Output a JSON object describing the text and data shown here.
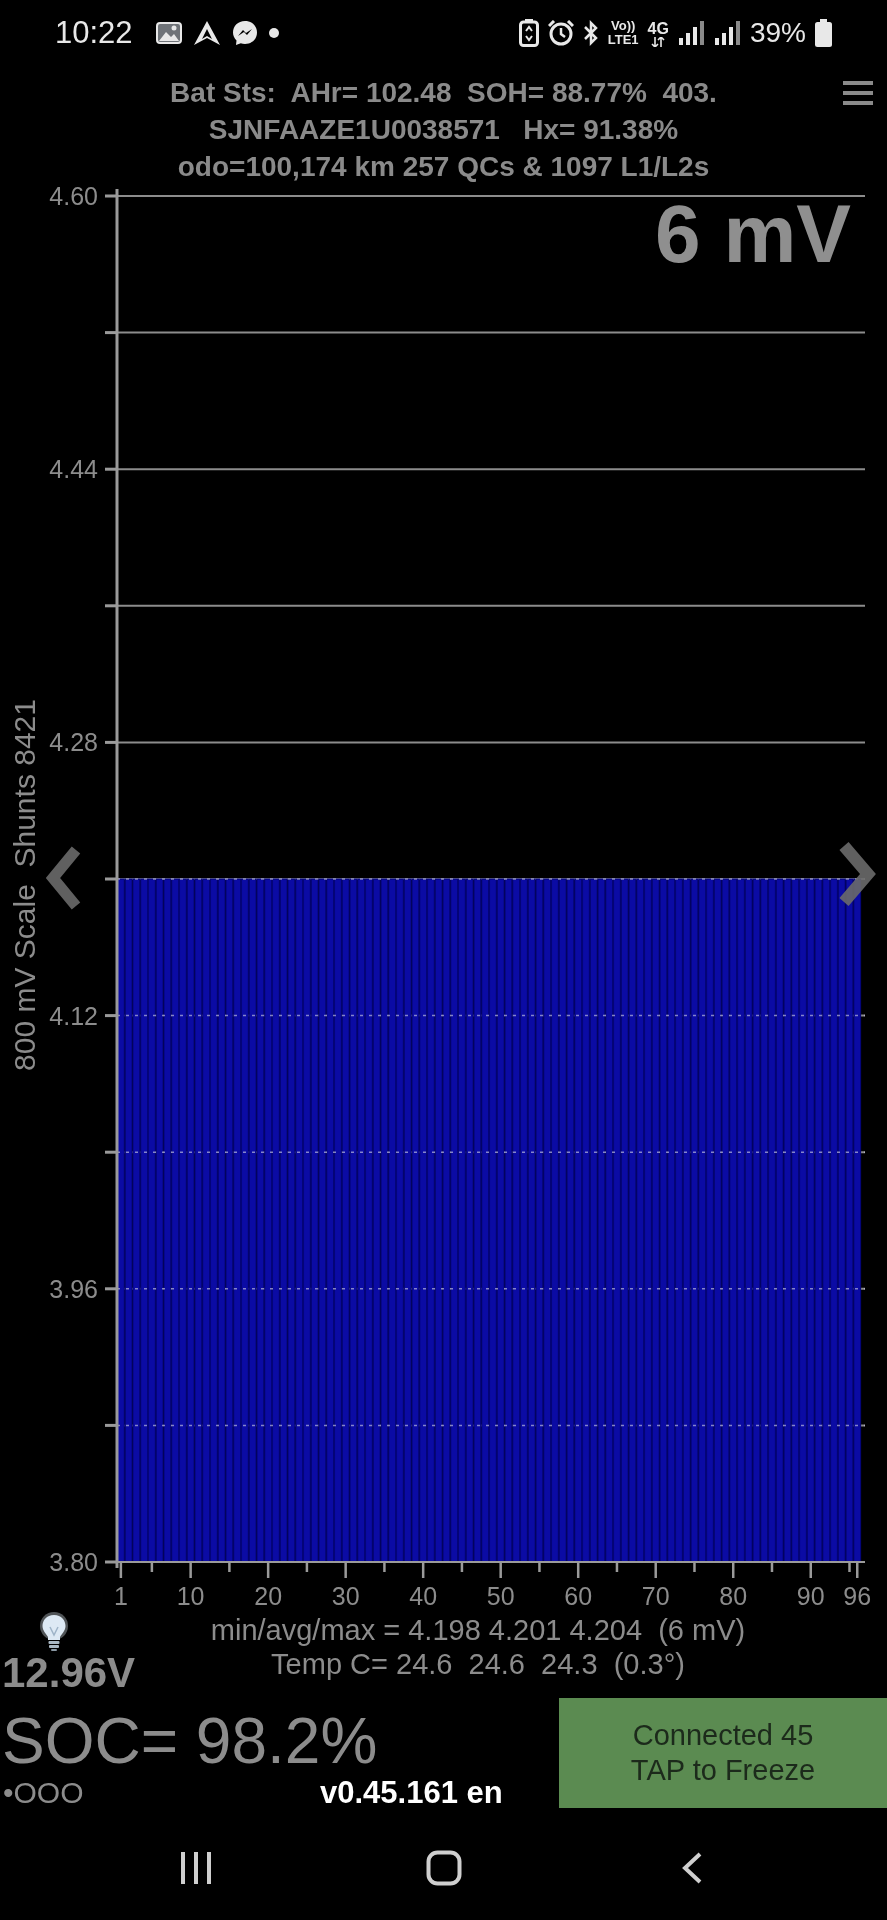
{
  "status_bar": {
    "time": "10:22",
    "volte": "Vo))",
    "volte_line": "LTE1",
    "network": "4G",
    "battery_percent": "39%"
  },
  "header": {
    "lines": [
      "Bat Sts:  AHr= 102.48  SOH= 88.77%  403.",
      "SJNFAAZE1U0038571   Hx= 91.38%",
      "odo=100,174 km 257 QCs & 1097 L1/L2s"
    ]
  },
  "chart": {
    "reading": "6 mV",
    "chart_data": {
      "type": "bar",
      "ylabel": "800 mV Scale  Shunts 8421",
      "x": [
        1,
        2,
        3,
        4,
        5,
        6,
        7,
        8,
        9,
        10,
        11,
        12,
        13,
        14,
        15,
        16,
        17,
        18,
        19,
        20,
        21,
        22,
        23,
        24,
        25,
        26,
        27,
        28,
        29,
        30,
        31,
        32,
        33,
        34,
        35,
        36,
        37,
        38,
        39,
        40,
        41,
        42,
        43,
        44,
        45,
        46,
        47,
        48,
        49,
        50,
        51,
        52,
        53,
        54,
        55,
        56,
        57,
        58,
        59,
        60,
        61,
        62,
        63,
        64,
        65,
        66,
        67,
        68,
        69,
        70,
        71,
        72,
        73,
        74,
        75,
        76,
        77,
        78,
        79,
        80,
        81,
        82,
        83,
        84,
        85,
        86,
        87,
        88,
        89,
        90,
        91,
        92,
        93,
        94,
        95,
        96
      ],
      "values": [
        4.2,
        4.2,
        4.2,
        4.2,
        4.2,
        4.2,
        4.2,
        4.2,
        4.2,
        4.2,
        4.2,
        4.2,
        4.2,
        4.2,
        4.2,
        4.2,
        4.2,
        4.2,
        4.2,
        4.2,
        4.2,
        4.2,
        4.2,
        4.2,
        4.2,
        4.2,
        4.2,
        4.2,
        4.2,
        4.2,
        4.2,
        4.2,
        4.2,
        4.2,
        4.2,
        4.2,
        4.2,
        4.2,
        4.2,
        4.2,
        4.2,
        4.2,
        4.2,
        4.2,
        4.2,
        4.2,
        4.2,
        4.2,
        4.2,
        4.2,
        4.2,
        4.2,
        4.2,
        4.2,
        4.2,
        4.2,
        4.2,
        4.2,
        4.2,
        4.2,
        4.2,
        4.2,
        4.2,
        4.2,
        4.2,
        4.2,
        4.2,
        4.2,
        4.2,
        4.2,
        4.2,
        4.2,
        4.2,
        4.2,
        4.2,
        4.2,
        4.2,
        4.2,
        4.2,
        4.2,
        4.2,
        4.2,
        4.2,
        4.2,
        4.2,
        4.2,
        4.2,
        4.2,
        4.2,
        4.2,
        4.2,
        4.2,
        4.2,
        4.2,
        4.2,
        4.2
      ],
      "xlim": [
        0.5,
        97
      ],
      "ylim": [
        3.8,
        4.6
      ],
      "xticks": [
        1,
        10,
        20,
        30,
        40,
        50,
        60,
        70,
        80,
        90,
        96
      ],
      "yticks": [
        {
          "value": 4.6,
          "label": "4.60"
        },
        {
          "value": 4.44,
          "label": "4.44"
        },
        {
          "value": 4.28,
          "label": "4.28"
        },
        {
          "value": 4.12,
          "label": "4.12"
        },
        {
          "value": 3.96,
          "label": "3.96"
        },
        {
          "value": 3.8,
          "label": "3.80"
        }
      ],
      "grid": true
    }
  },
  "stats": {
    "voltages": "min/avg/max = 4.198 4.201 4.204  (6 mV)",
    "temperatures": "Temp C= 24.6  24.6  24.3  (0.3°)"
  },
  "aux_battery": {
    "voltage": "12.96V"
  },
  "soc": "SOC= 98.2%",
  "indicator": "•OOO",
  "version": "v0.45.161 en",
  "connection_button": {
    "lines": [
      "Connected 45",
      "TAP to Freeze"
    ]
  }
}
